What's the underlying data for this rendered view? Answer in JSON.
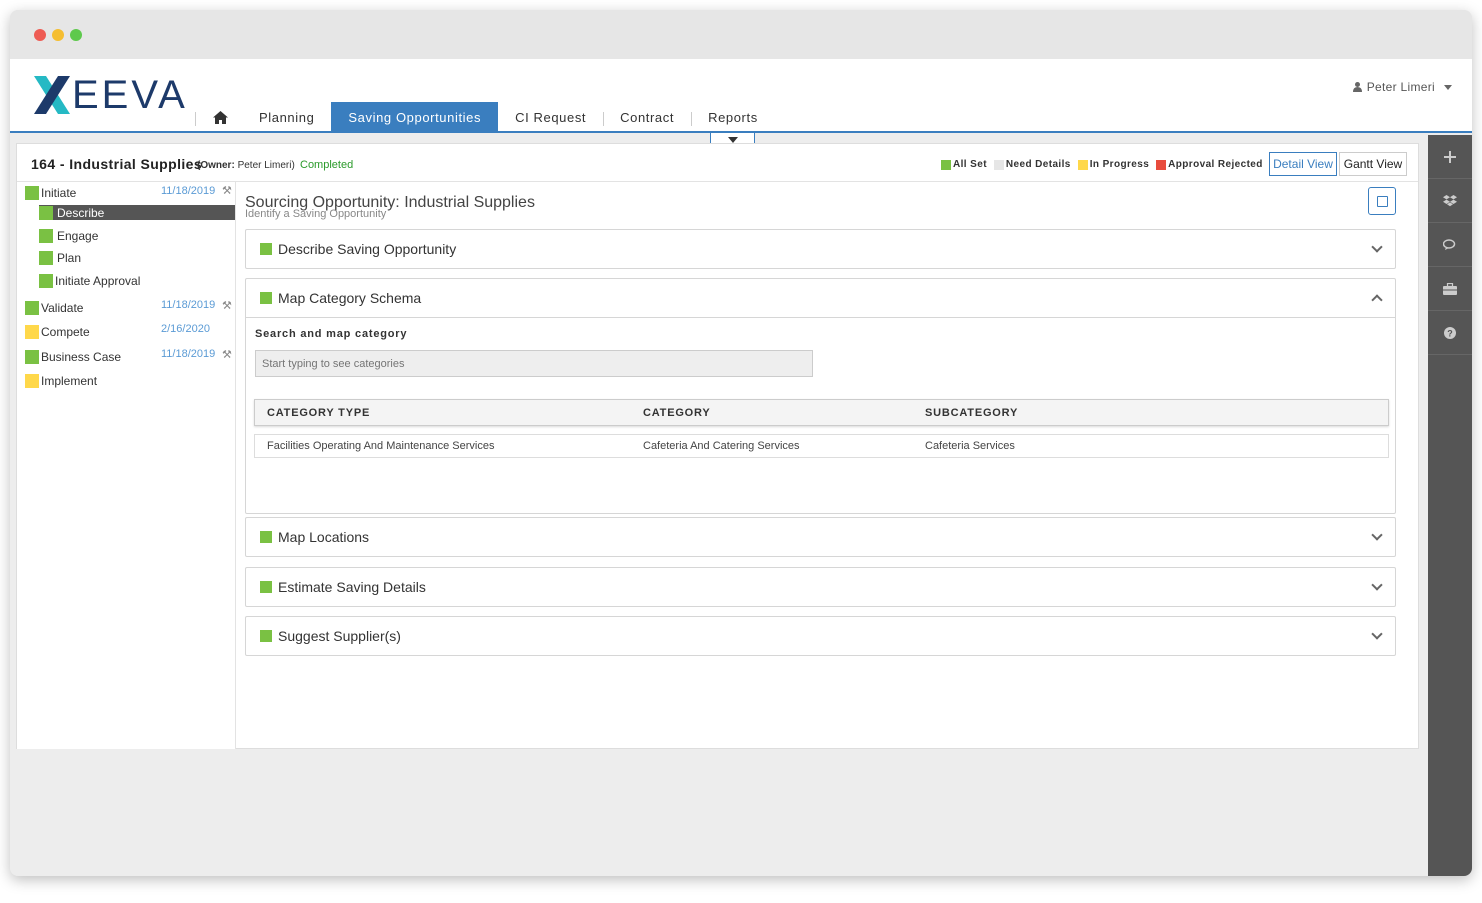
{
  "brand": {
    "logo_text": "EEVA",
    "accent": "#3a7ebf",
    "green": "#7ac143",
    "yellow": "#ffd84a",
    "red": "#e84c3d"
  },
  "nav": {
    "home_icon": "home-icon",
    "items": [
      {
        "label": "Planning"
      },
      {
        "label": "Saving Opportunities"
      },
      {
        "label": "CI Request"
      },
      {
        "label": "Contract"
      },
      {
        "label": "Reports"
      }
    ],
    "active": "Saving Opportunities"
  },
  "user": {
    "name": "Peter Limeri"
  },
  "header": {
    "title": "164 - Industrial Supplies",
    "owner_label": "(Owner:",
    "owner_name": "Peter Limeri)",
    "status": "Completed",
    "legend": [
      {
        "label": "All Set",
        "color": "#7ac143"
      },
      {
        "label": "Need Details",
        "color": "#e6e6e6"
      },
      {
        "label": "In Progress",
        "color": "#ffd84a"
      },
      {
        "label": "Approval Rejected",
        "color": "#e84c3d"
      }
    ],
    "detail_view": "Detail View",
    "gantt_view": "Gantt View"
  },
  "sidebar": {
    "stages": [
      {
        "label": "Initiate",
        "date": "11/18/2019",
        "color": "#7ac143",
        "icon": "gavel-icon"
      },
      {
        "label": "Validate",
        "date": "11/18/2019",
        "color": "#7ac143",
        "icon": "gavel-icon"
      },
      {
        "label": "Compete",
        "date": "2/16/2020",
        "color": "#ffd84a"
      },
      {
        "label": "Business Case",
        "date": "11/18/2019",
        "color": "#7ac143",
        "icon": "gavel-icon"
      },
      {
        "label": "Implement",
        "date": "",
        "color": "#ffd84a"
      }
    ],
    "substeps": [
      {
        "label": "Describe",
        "active": true
      },
      {
        "label": "Engage"
      },
      {
        "label": "Plan"
      },
      {
        "label": "Initiate Approval"
      }
    ]
  },
  "main": {
    "title": "Sourcing Opportunity: Industrial Supplies",
    "subtitle": "Identify a Saving Opportunity",
    "panels": [
      {
        "title": "Describe Saving Opportunity",
        "expanded": false
      },
      {
        "title": "Map Category Schema",
        "expanded": true
      },
      {
        "title": "Map Locations",
        "expanded": false
      },
      {
        "title": "Estimate Saving Details",
        "expanded": false
      },
      {
        "title": "Suggest Supplier(s)",
        "expanded": false
      }
    ],
    "category": {
      "search_label": "Search and map category",
      "search_placeholder": "Start typing to see categories",
      "columns": [
        "CATEGORY TYPE",
        "CATEGORY",
        "SUBCATEGORY"
      ],
      "rows": [
        [
          "Facilities Operating And Maintenance Services",
          "Cafeteria And Catering Services",
          "Cafeteria Services"
        ]
      ]
    }
  },
  "right_toolbar": [
    "plus-icon",
    "dropbox-icon",
    "chat-icon",
    "briefcase-icon",
    "help-icon"
  ]
}
